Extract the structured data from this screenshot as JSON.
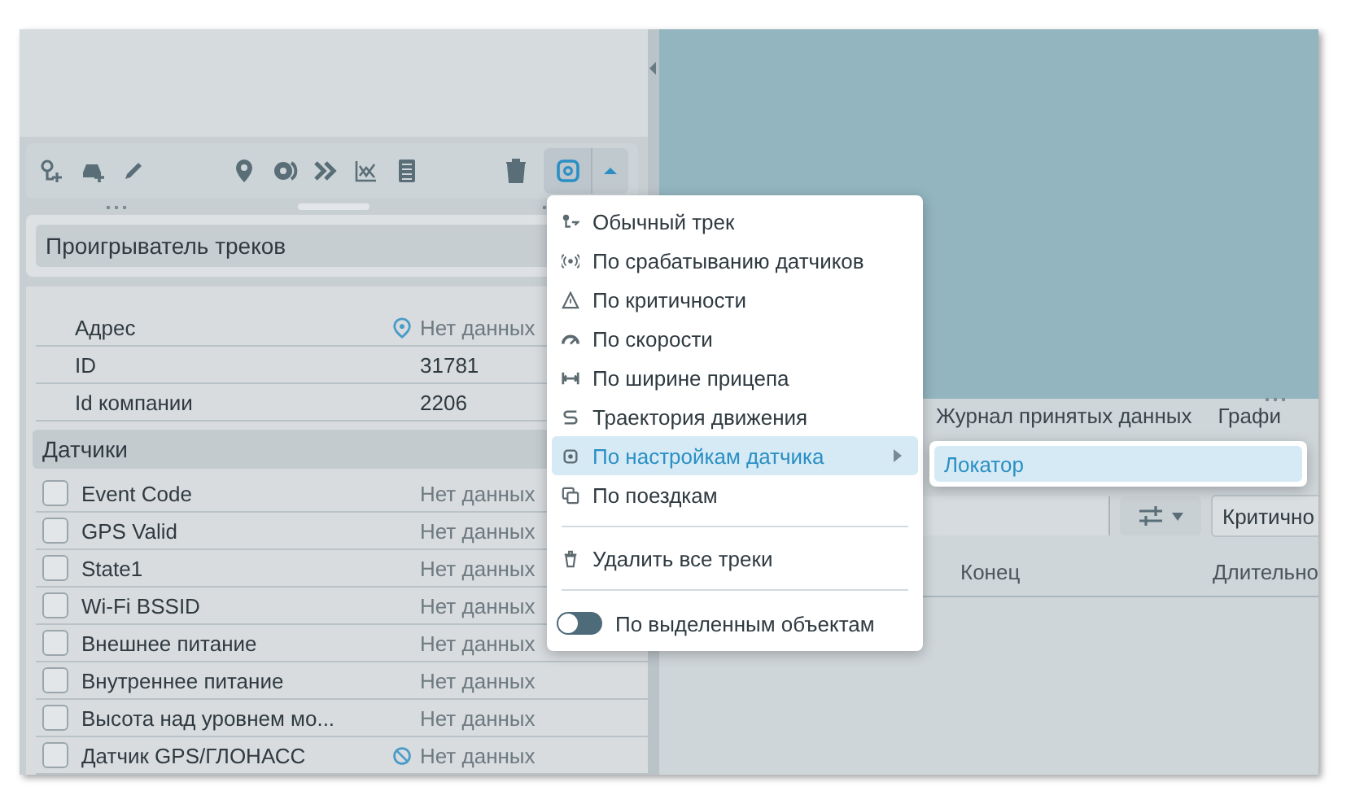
{
  "player": {
    "title": "Проигрыватель треков"
  },
  "info_rows": [
    {
      "label": "Адрес",
      "value": "Нет данных",
      "muted": true
    },
    {
      "label": "ID",
      "value": "31781",
      "muted": false
    },
    {
      "label": "Id компании",
      "value": "2206",
      "muted": false
    }
  ],
  "sensors_section": {
    "title": "Датчики"
  },
  "sensors": [
    {
      "label": "Event Code",
      "value": "Нет данных",
      "checked": false
    },
    {
      "label": "GPS Valid",
      "value": "Нет данных",
      "checked": false
    },
    {
      "label": "State1",
      "value": "Нет данных",
      "checked": false
    },
    {
      "label": "Wi-Fi BSSID",
      "value": "Нет данных",
      "checked": false
    },
    {
      "label": "Внешнее питание",
      "value": "Нет данных",
      "checked": false
    },
    {
      "label": "Внутреннее питание",
      "value": "Нет данных",
      "checked": false
    },
    {
      "label": "Высота над уровнем мо...",
      "value": "Нет данных",
      "checked": false
    },
    {
      "label": "Датчик GPS/ГЛОНАСС",
      "value": "Нет данных",
      "checked": false
    }
  ],
  "log_tabs": [
    {
      "label": "Журнал принятых данных",
      "selected": false
    },
    {
      "label": "Графи",
      "selected": false
    }
  ],
  "filter": {
    "value": "Критично"
  },
  "log_table": {
    "columns": [
      "Конец",
      "Длительно"
    ]
  },
  "track_menu": [
    {
      "kind": "item",
      "label": "Обычный трек",
      "selected": false,
      "submenu": false
    },
    {
      "kind": "item",
      "label": "По срабатыванию датчиков",
      "selected": false,
      "submenu": false
    },
    {
      "kind": "item",
      "label": "По критичности",
      "selected": false,
      "submenu": false
    },
    {
      "kind": "item",
      "label": "По скорости",
      "selected": false,
      "submenu": false
    },
    {
      "kind": "item",
      "label": "По ширине прицепа",
      "selected": false,
      "submenu": false
    },
    {
      "kind": "item",
      "label": "Траектория движения",
      "selected": false,
      "submenu": false
    },
    {
      "kind": "item",
      "label": "По настройкам датчика",
      "selected": true,
      "submenu": true
    },
    {
      "kind": "item",
      "label": "По поездкам",
      "selected": false,
      "submenu": false
    },
    {
      "kind": "divider"
    },
    {
      "kind": "item",
      "label": "Удалить все треки",
      "selected": false,
      "submenu": false
    },
    {
      "kind": "divider"
    },
    {
      "kind": "toggle",
      "label": "По выделенным объектам",
      "on": false
    }
  ],
  "submenu": [
    {
      "label": "Локатор",
      "selected": true
    }
  ]
}
